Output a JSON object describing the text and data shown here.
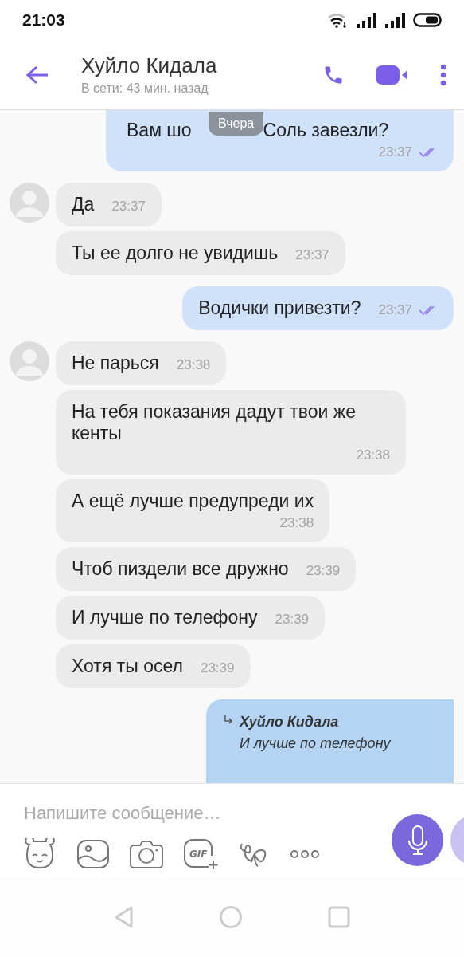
{
  "status_bar": {
    "time": "21:03"
  },
  "header": {
    "name": "Хуйло Кидала",
    "status": "В сети: 43 мин. назад"
  },
  "date_chip": "Вчера",
  "messages": [
    {
      "kind": "outgoing",
      "text_parts": [
        "Вам шо",
        "Соль завезли?"
      ],
      "time": "23:37",
      "read": true,
      "time_below": true,
      "clipped": true
    },
    {
      "kind": "incoming",
      "text": "Да",
      "time": "23:37",
      "avatar": true,
      "time_below": false
    },
    {
      "kind": "incoming",
      "text": "Ты ее долго не увидишь",
      "time": "23:37",
      "avatar": false,
      "time_below": false
    },
    {
      "kind": "outgoing",
      "text": "Водички привезти?",
      "time": "23:37",
      "read": true,
      "time_below": false,
      "clipped": false
    },
    {
      "kind": "incoming",
      "text": "Не парься",
      "time": "23:38",
      "avatar": true,
      "time_below": false
    },
    {
      "kind": "incoming",
      "text": "На тебя показания дадут твои же кенты",
      "time": "23:38",
      "avatar": false,
      "time_below": true
    },
    {
      "kind": "incoming",
      "text": "А ещё лучше предупреди их",
      "time": "23:38",
      "avatar": false,
      "time_below": true
    },
    {
      "kind": "incoming",
      "text": "Чтоб пиздели все дружно",
      "time": "23:39",
      "avatar": false,
      "time_below": false
    },
    {
      "kind": "incoming",
      "text": "И лучше по телефону",
      "time": "23:39",
      "avatar": false,
      "time_below": false
    },
    {
      "kind": "incoming",
      "text": "Хотя ты осел",
      "time": "23:39",
      "avatar": false,
      "time_below": false
    },
    {
      "kind": "reply",
      "quote_author": "Хуйло Кидала",
      "quote_text": "И лучше по телефону"
    }
  ],
  "composer": {
    "placeholder": "Напишите сообщение…",
    "gif_label": "GIF"
  }
}
